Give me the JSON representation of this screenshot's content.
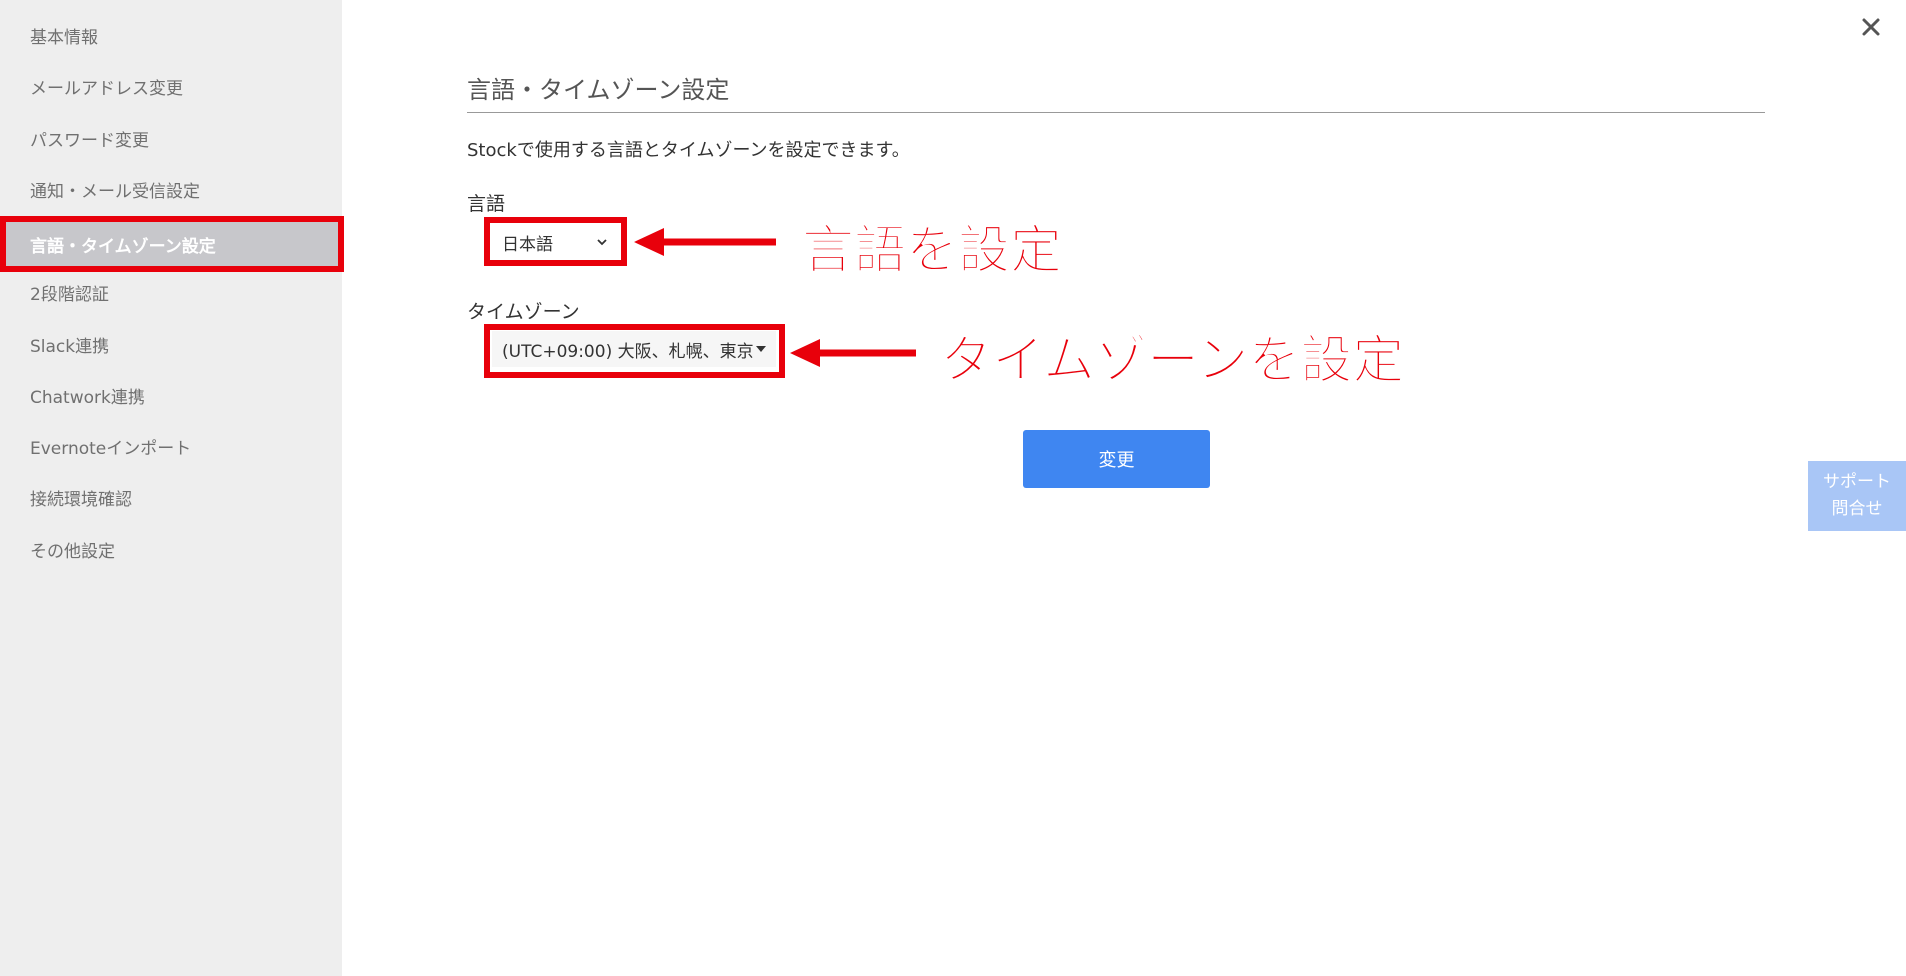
{
  "sidebar": {
    "items": [
      {
        "label": "基本情報"
      },
      {
        "label": "メールアドレス変更"
      },
      {
        "label": "パスワード変更"
      },
      {
        "label": "通知・メール受信設定"
      },
      {
        "label": "言語・タイムゾーン設定",
        "active": true
      },
      {
        "label": "2段階認証"
      },
      {
        "label": "Slack連携"
      },
      {
        "label": "Chatwork連携"
      },
      {
        "label": "Evernoteインポート"
      },
      {
        "label": "接続環境確認"
      },
      {
        "label": "その他設定"
      }
    ]
  },
  "main": {
    "title": "言語・タイムゾーン設定",
    "description": "Stockで使用する言語とタイムゾーンを設定できます。",
    "language": {
      "label": "言語",
      "selected": "日本語"
    },
    "timezone": {
      "label": "タイムゾーン",
      "selected": "(UTC+09:00) 大阪、札幌、東京"
    },
    "submit_label": "変更"
  },
  "annotations": {
    "language_note": "言語を設定",
    "timezone_note": "タイムゾーンを設定"
  },
  "support": {
    "line1": "サポート",
    "line2": "問合せ"
  },
  "icons": {
    "close": "close-icon",
    "language_caret": "chevron-down-icon",
    "timezone_caret": "caret-down-icon"
  },
  "colors": {
    "annotation_red": "#e8000b",
    "primary_button": "#3f86f1",
    "support_tab": "#a9c6f6",
    "sidebar_bg": "#eeeeee",
    "sidebar_active_bg": "#c7c7cb"
  }
}
